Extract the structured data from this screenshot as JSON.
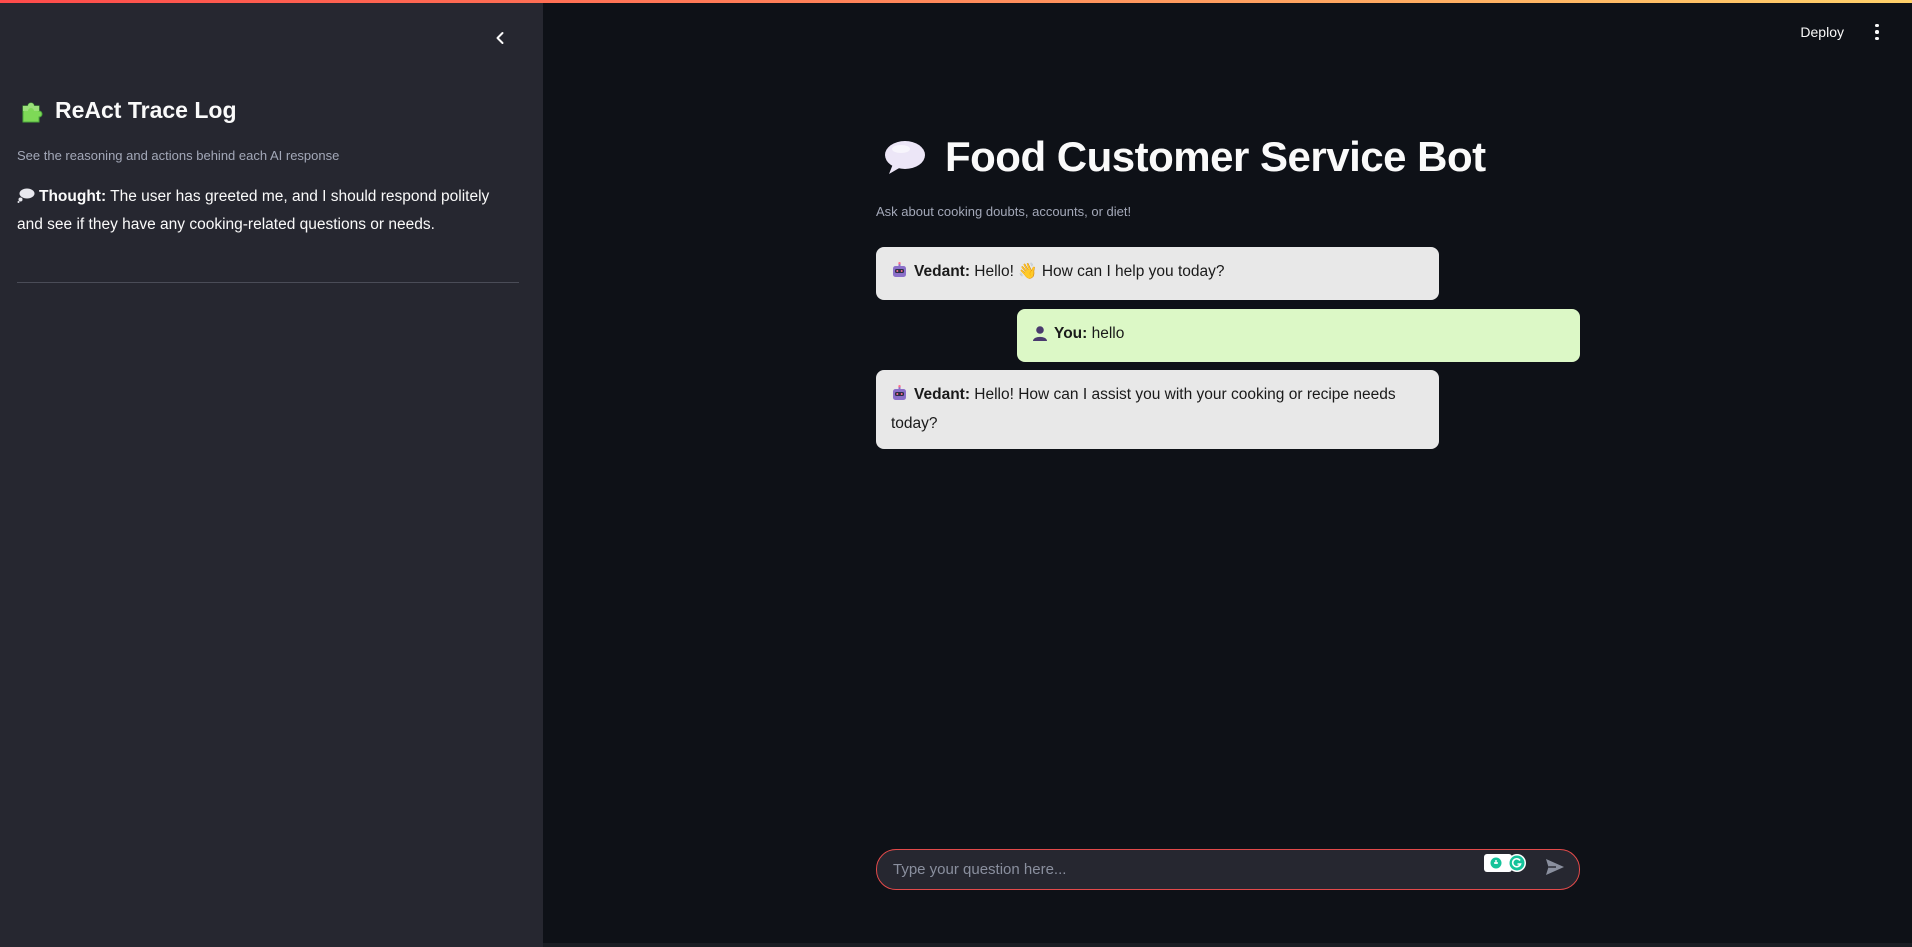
{
  "sidebar": {
    "title": "ReAct Trace Log",
    "subtitle": "See the reasoning and actions behind each AI response",
    "thought_label": "Thought:",
    "thought_text": " The user has greeted me, and I should respond politely and see if they have any cooking-related questions or needs."
  },
  "header": {
    "deploy_label": "Deploy"
  },
  "main": {
    "title": "Food Customer Service Bot",
    "caption": "Ask about cooking doubts, accounts, or diet!"
  },
  "messages": [
    {
      "role": "bot",
      "speaker": "Vedant:",
      "text": " Hello! 👋 How can I help you today?"
    },
    {
      "role": "user",
      "speaker": "You:",
      "text": " hello"
    },
    {
      "role": "bot",
      "speaker": "Vedant:",
      "text": " Hello! How can I assist you with your cooking or recipe needs today?"
    }
  ],
  "chat_input": {
    "placeholder": "Type your question here...",
    "value": ""
  },
  "colors": {
    "accent_border": "#e24a4a",
    "bot_bubble": "#e8e8e8",
    "user_bubble": "#dcf8c6",
    "sidebar_bg": "#262730",
    "main_bg": "#0e1117"
  },
  "icons": {
    "sidebar_title": "puzzle-piece-icon",
    "thought": "thought-balloon-icon",
    "main_title": "speech-balloon-icon",
    "bot_avatar": "robot-icon",
    "user_avatar": "person-icon",
    "send": "send-icon",
    "collapse": "chevron-left-icon",
    "menu": "kebab-menu-icon"
  }
}
